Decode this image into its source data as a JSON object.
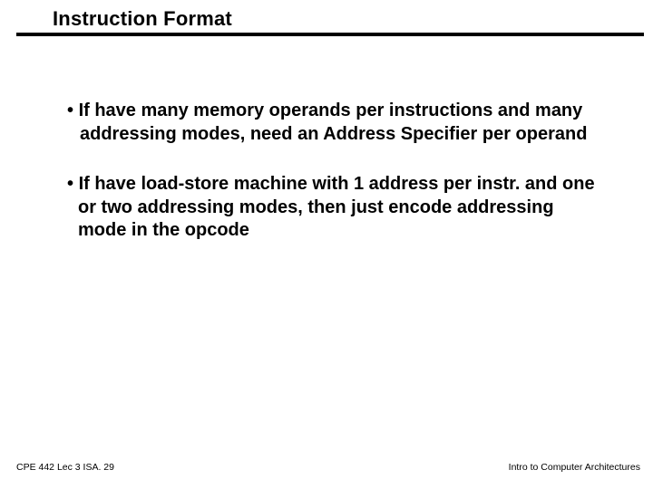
{
  "title": "Instruction Format",
  "bullets": {
    "b1_prefix": "• ",
    "b1": "If have many memory operands per instructions and many addressing modes, need an Address Specifier per operand",
    "b2_prefix": "• ",
    "b2": "If have load-store machine with 1 address per instr. and one or two addressing modes, then just encode addressing mode in the opcode"
  },
  "footer": {
    "left": "CPE 442  Lec 3 ISA. 29",
    "right": "Intro to Computer Architectures"
  }
}
